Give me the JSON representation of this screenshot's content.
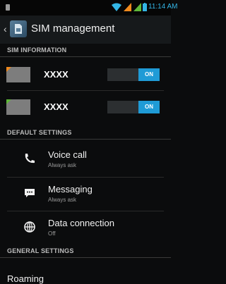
{
  "status_bar": {
    "time": "11:14 AM"
  },
  "action_bar": {
    "title": "SIM management"
  },
  "sections": {
    "sim_information": "SIM INFORMATION",
    "default_settings": "DEFAULT SETTINGS",
    "general_settings": "GENERAL SETTINGS"
  },
  "sims": [
    {
      "name": "XXXX",
      "toggle": "ON",
      "color": "#f08a1e"
    },
    {
      "name": "XXXX",
      "toggle": "ON",
      "color": "#5fb83a"
    }
  ],
  "default_settings": [
    {
      "title": "Voice call",
      "subtitle": "Always ask",
      "icon": "phone-icon"
    },
    {
      "title": "Messaging",
      "subtitle": "Always ask",
      "icon": "message-icon"
    },
    {
      "title": "Data connection",
      "subtitle": "Off",
      "icon": "globe-icon"
    }
  ],
  "general_settings": [
    {
      "title": "Roaming"
    }
  ],
  "colors": {
    "accent": "#33b5e5",
    "toggle_on": "#1f9bd6"
  }
}
